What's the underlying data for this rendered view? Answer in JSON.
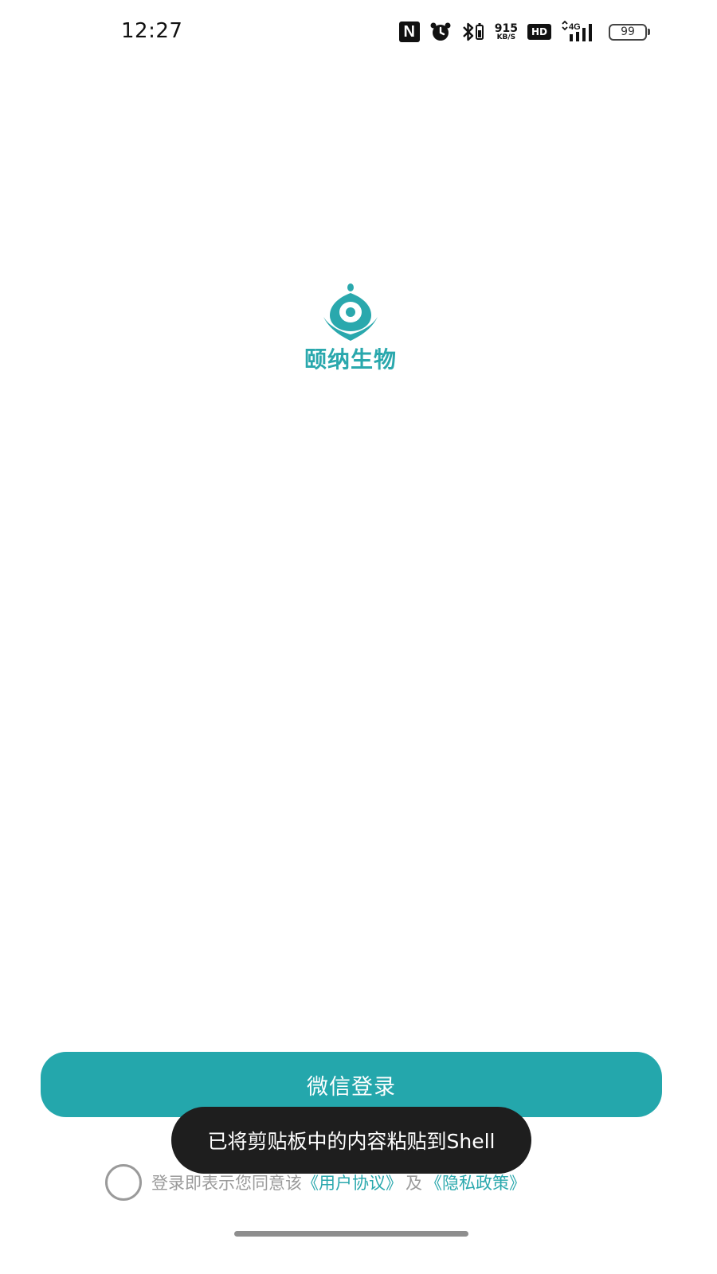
{
  "status_bar": {
    "time": "12:27",
    "nfc_label": "N",
    "net_speed_value": "915",
    "net_speed_unit": "KB/S",
    "hd_label": "HD",
    "network_type": "4G",
    "battery_level": "99"
  },
  "brand": {
    "name": "颐纳生物",
    "color": "#2aa8ad"
  },
  "login": {
    "wechat_button_label": "微信登录",
    "button_color": "#24a7ac"
  },
  "toast": {
    "message": "已将剪贴板中的内容粘贴到Shell"
  },
  "agreement": {
    "prefix": "登录即表示您同意该",
    "user_agreement_link": "《用户协议》",
    "and": "及",
    "privacy_policy_link": "《隐私政策》"
  }
}
